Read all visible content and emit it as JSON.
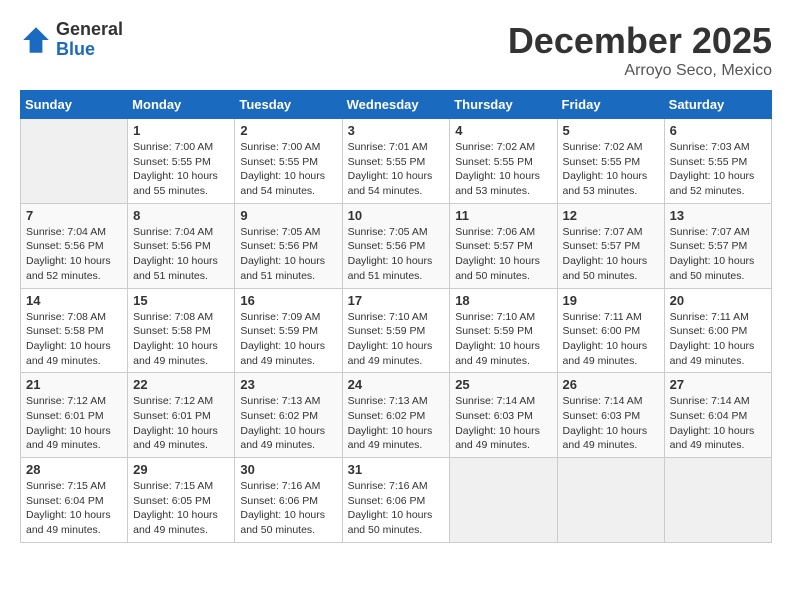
{
  "logo": {
    "general": "General",
    "blue": "Blue"
  },
  "title": "December 2025",
  "location": "Arroyo Seco, Mexico",
  "weekdays": [
    "Sunday",
    "Monday",
    "Tuesday",
    "Wednesday",
    "Thursday",
    "Friday",
    "Saturday"
  ],
  "weeks": [
    [
      {
        "day": "",
        "info": ""
      },
      {
        "day": "1",
        "info": "Sunrise: 7:00 AM\nSunset: 5:55 PM\nDaylight: 10 hours\nand 55 minutes."
      },
      {
        "day": "2",
        "info": "Sunrise: 7:00 AM\nSunset: 5:55 PM\nDaylight: 10 hours\nand 54 minutes."
      },
      {
        "day": "3",
        "info": "Sunrise: 7:01 AM\nSunset: 5:55 PM\nDaylight: 10 hours\nand 54 minutes."
      },
      {
        "day": "4",
        "info": "Sunrise: 7:02 AM\nSunset: 5:55 PM\nDaylight: 10 hours\nand 53 minutes."
      },
      {
        "day": "5",
        "info": "Sunrise: 7:02 AM\nSunset: 5:55 PM\nDaylight: 10 hours\nand 53 minutes."
      },
      {
        "day": "6",
        "info": "Sunrise: 7:03 AM\nSunset: 5:55 PM\nDaylight: 10 hours\nand 52 minutes."
      }
    ],
    [
      {
        "day": "7",
        "info": "Sunrise: 7:04 AM\nSunset: 5:56 PM\nDaylight: 10 hours\nand 52 minutes."
      },
      {
        "day": "8",
        "info": "Sunrise: 7:04 AM\nSunset: 5:56 PM\nDaylight: 10 hours\nand 51 minutes."
      },
      {
        "day": "9",
        "info": "Sunrise: 7:05 AM\nSunset: 5:56 PM\nDaylight: 10 hours\nand 51 minutes."
      },
      {
        "day": "10",
        "info": "Sunrise: 7:05 AM\nSunset: 5:56 PM\nDaylight: 10 hours\nand 51 minutes."
      },
      {
        "day": "11",
        "info": "Sunrise: 7:06 AM\nSunset: 5:57 PM\nDaylight: 10 hours\nand 50 minutes."
      },
      {
        "day": "12",
        "info": "Sunrise: 7:07 AM\nSunset: 5:57 PM\nDaylight: 10 hours\nand 50 minutes."
      },
      {
        "day": "13",
        "info": "Sunrise: 7:07 AM\nSunset: 5:57 PM\nDaylight: 10 hours\nand 50 minutes."
      }
    ],
    [
      {
        "day": "14",
        "info": "Sunrise: 7:08 AM\nSunset: 5:58 PM\nDaylight: 10 hours\nand 49 minutes."
      },
      {
        "day": "15",
        "info": "Sunrise: 7:08 AM\nSunset: 5:58 PM\nDaylight: 10 hours\nand 49 minutes."
      },
      {
        "day": "16",
        "info": "Sunrise: 7:09 AM\nSunset: 5:59 PM\nDaylight: 10 hours\nand 49 minutes."
      },
      {
        "day": "17",
        "info": "Sunrise: 7:10 AM\nSunset: 5:59 PM\nDaylight: 10 hours\nand 49 minutes."
      },
      {
        "day": "18",
        "info": "Sunrise: 7:10 AM\nSunset: 5:59 PM\nDaylight: 10 hours\nand 49 minutes."
      },
      {
        "day": "19",
        "info": "Sunrise: 7:11 AM\nSunset: 6:00 PM\nDaylight: 10 hours\nand 49 minutes."
      },
      {
        "day": "20",
        "info": "Sunrise: 7:11 AM\nSunset: 6:00 PM\nDaylight: 10 hours\nand 49 minutes."
      }
    ],
    [
      {
        "day": "21",
        "info": "Sunrise: 7:12 AM\nSunset: 6:01 PM\nDaylight: 10 hours\nand 49 minutes."
      },
      {
        "day": "22",
        "info": "Sunrise: 7:12 AM\nSunset: 6:01 PM\nDaylight: 10 hours\nand 49 minutes."
      },
      {
        "day": "23",
        "info": "Sunrise: 7:13 AM\nSunset: 6:02 PM\nDaylight: 10 hours\nand 49 minutes."
      },
      {
        "day": "24",
        "info": "Sunrise: 7:13 AM\nSunset: 6:02 PM\nDaylight: 10 hours\nand 49 minutes."
      },
      {
        "day": "25",
        "info": "Sunrise: 7:14 AM\nSunset: 6:03 PM\nDaylight: 10 hours\nand 49 minutes."
      },
      {
        "day": "26",
        "info": "Sunrise: 7:14 AM\nSunset: 6:03 PM\nDaylight: 10 hours\nand 49 minutes."
      },
      {
        "day": "27",
        "info": "Sunrise: 7:14 AM\nSunset: 6:04 PM\nDaylight: 10 hours\nand 49 minutes."
      }
    ],
    [
      {
        "day": "28",
        "info": "Sunrise: 7:15 AM\nSunset: 6:04 PM\nDaylight: 10 hours\nand 49 minutes."
      },
      {
        "day": "29",
        "info": "Sunrise: 7:15 AM\nSunset: 6:05 PM\nDaylight: 10 hours\nand 49 minutes."
      },
      {
        "day": "30",
        "info": "Sunrise: 7:16 AM\nSunset: 6:06 PM\nDaylight: 10 hours\nand 50 minutes."
      },
      {
        "day": "31",
        "info": "Sunrise: 7:16 AM\nSunset: 6:06 PM\nDaylight: 10 hours\nand 50 minutes."
      },
      {
        "day": "",
        "info": ""
      },
      {
        "day": "",
        "info": ""
      },
      {
        "day": "",
        "info": ""
      }
    ]
  ]
}
